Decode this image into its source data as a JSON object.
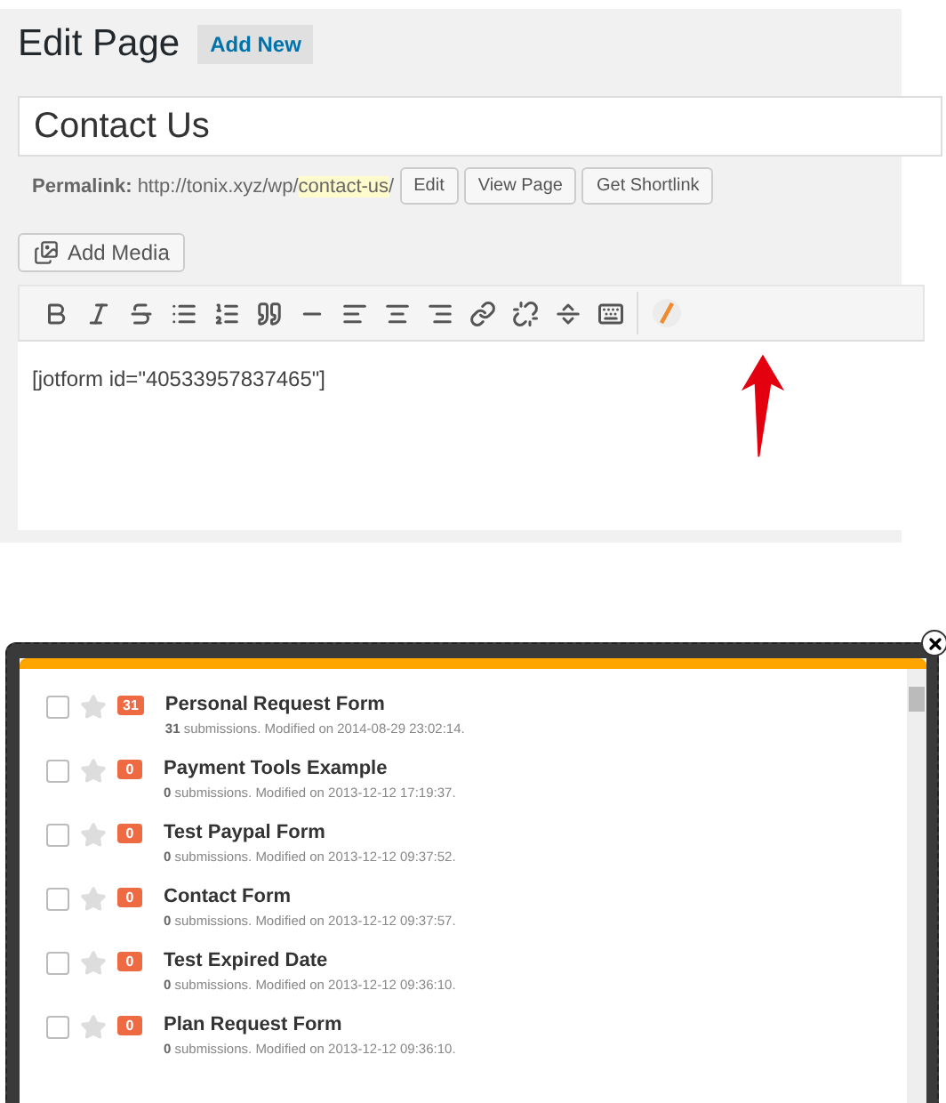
{
  "header": {
    "title": "Edit Page",
    "add_new": "Add New"
  },
  "page_title": {
    "value": "Contact Us"
  },
  "permalink": {
    "label": "Permalink:",
    "base": "http://tonix.xyz/wp/",
    "slug": "contact-us",
    "trail": "/",
    "buttons": [
      "Edit",
      "View Page",
      "Get Shortlink"
    ]
  },
  "add_media": "Add Media",
  "editor": {
    "content": "[jotform id=\"40533957837465\"]"
  },
  "forms_dialog": {
    "forms": [
      {
        "title": "Personal Request Form",
        "count": "31",
        "details": "**31** submissions. Modified on 2014-08-29 23:02:14.",
        "checked": false,
        "starred": false
      },
      {
        "title": "Payment Tools Example",
        "count": "0",
        "details": "**0** submissions. Modified on 2013-12-12 17:19:37.",
        "checked": false,
        "starred": false
      },
      {
        "title": "Test Paypal Form",
        "count": "0",
        "details": "**0** submissions. Modified on 2013-12-12 09:37:52.",
        "checked": false,
        "starred": false
      },
      {
        "title": "Contact Form",
        "count": "0",
        "details": "**0** submissions. Modified on 2013-12-12 09:37:57.",
        "checked": false,
        "starred": false
      },
      {
        "title": "Test Expired Date",
        "count": "0",
        "details": "**0** submissions. Modified on 2013-12-12 09:36:10.",
        "checked": false,
        "starred": false
      },
      {
        "title": "Plan Request Form",
        "count": "0",
        "details": "**0** submissions. Modified on 2013-12-12 09:36:10.",
        "checked": false,
        "starred": false
      }
    ]
  }
}
